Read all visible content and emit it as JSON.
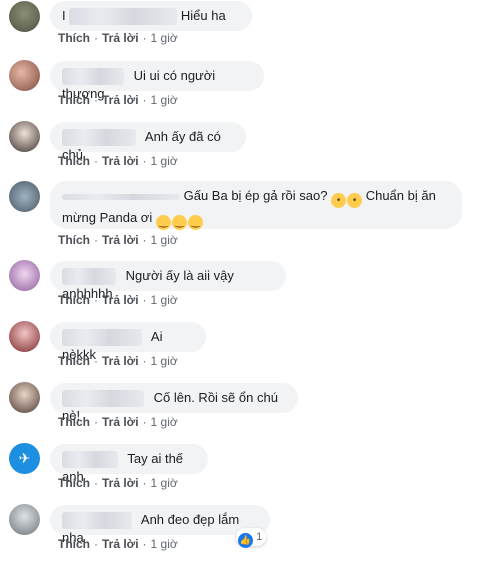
{
  "actions": {
    "like": "Thích",
    "reply": "Trả lời",
    "sep": "·",
    "time": "1 giờ"
  },
  "comments": [
    {
      "text": "Hiểu ha",
      "prefix": "I"
    },
    {
      "text": "Ui ui có người thương"
    },
    {
      "text": "Anh ấy đã có chủ"
    },
    {
      "line1": "Gấu Ba bị ép gả rồi sao?",
      "line1b": "Chuẩn bị ăn",
      "line2": "mừng Panda ơi"
    },
    {
      "text": "Người ấy là aii vậy anhhhhh"
    },
    {
      "text": "Ai nèkkk"
    },
    {
      "text": "Cố lên. Rồi sẽ ổn chú nè!"
    },
    {
      "text": "Tay ai thế anh"
    },
    {
      "text": "Anh đeo đẹp lắm nha",
      "reaction_count": "1"
    }
  ],
  "icons": {
    "like": "thumbs-up-icon",
    "emoji_shock": "astonished-face-icon",
    "emoji_smile": "smiling-face-icon"
  },
  "colors": {
    "bubble": "#f2f3f5",
    "link": "#4b4f56",
    "like_blue": "#1877f2"
  }
}
